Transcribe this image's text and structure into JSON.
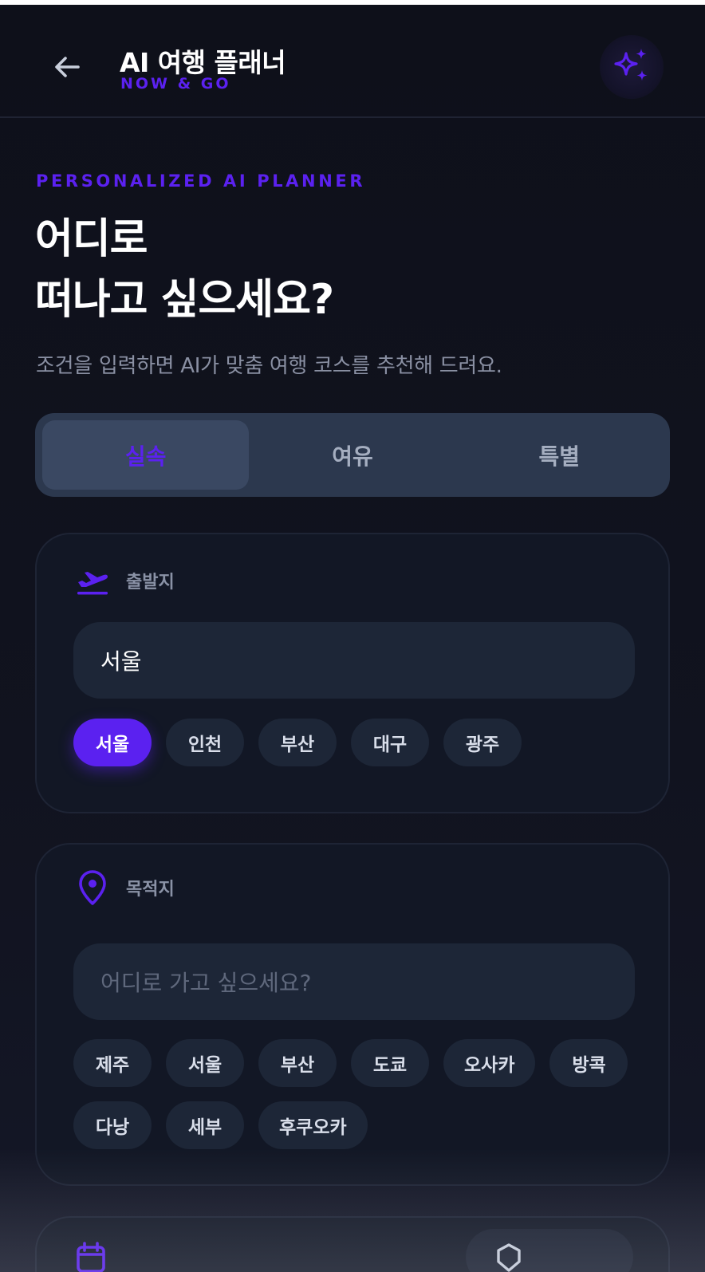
{
  "header": {
    "title": "AI 여행 플래너",
    "subtitle": "NOW & GO",
    "back_icon": "arrow-left-icon",
    "ai_icon": "sparkles-icon"
  },
  "hero": {
    "eyebrow": "PERSONALIZED AI PLANNER",
    "title_line1": "어디로",
    "title_line2": "떠나고 싶으세요?",
    "description": "조건을 입력하면 AI가 맞춤 여행 코스를 추천해 드려요."
  },
  "segment": {
    "items": [
      "실속",
      "여유",
      "특별"
    ],
    "selected": "실속"
  },
  "origin": {
    "label": "출발지",
    "icon": "airplane-takeoff-icon",
    "value": "서울",
    "chips": [
      "서울",
      "인천",
      "부산",
      "대구",
      "광주"
    ],
    "selected_chip": "서울"
  },
  "destination": {
    "label": "목적지",
    "icon": "map-pin-icon",
    "placeholder": "어디로 가고 싶으세요?",
    "chips": [
      "제주",
      "서울",
      "부산",
      "도쿄",
      "오사카",
      "방콕",
      "다낭",
      "세부",
      "후쿠오카"
    ]
  },
  "colors": {
    "accent": "#5b21f0",
    "background": "#0f111c",
    "card": "#121725",
    "field": "#1d2637",
    "segment": "#2c384e"
  }
}
